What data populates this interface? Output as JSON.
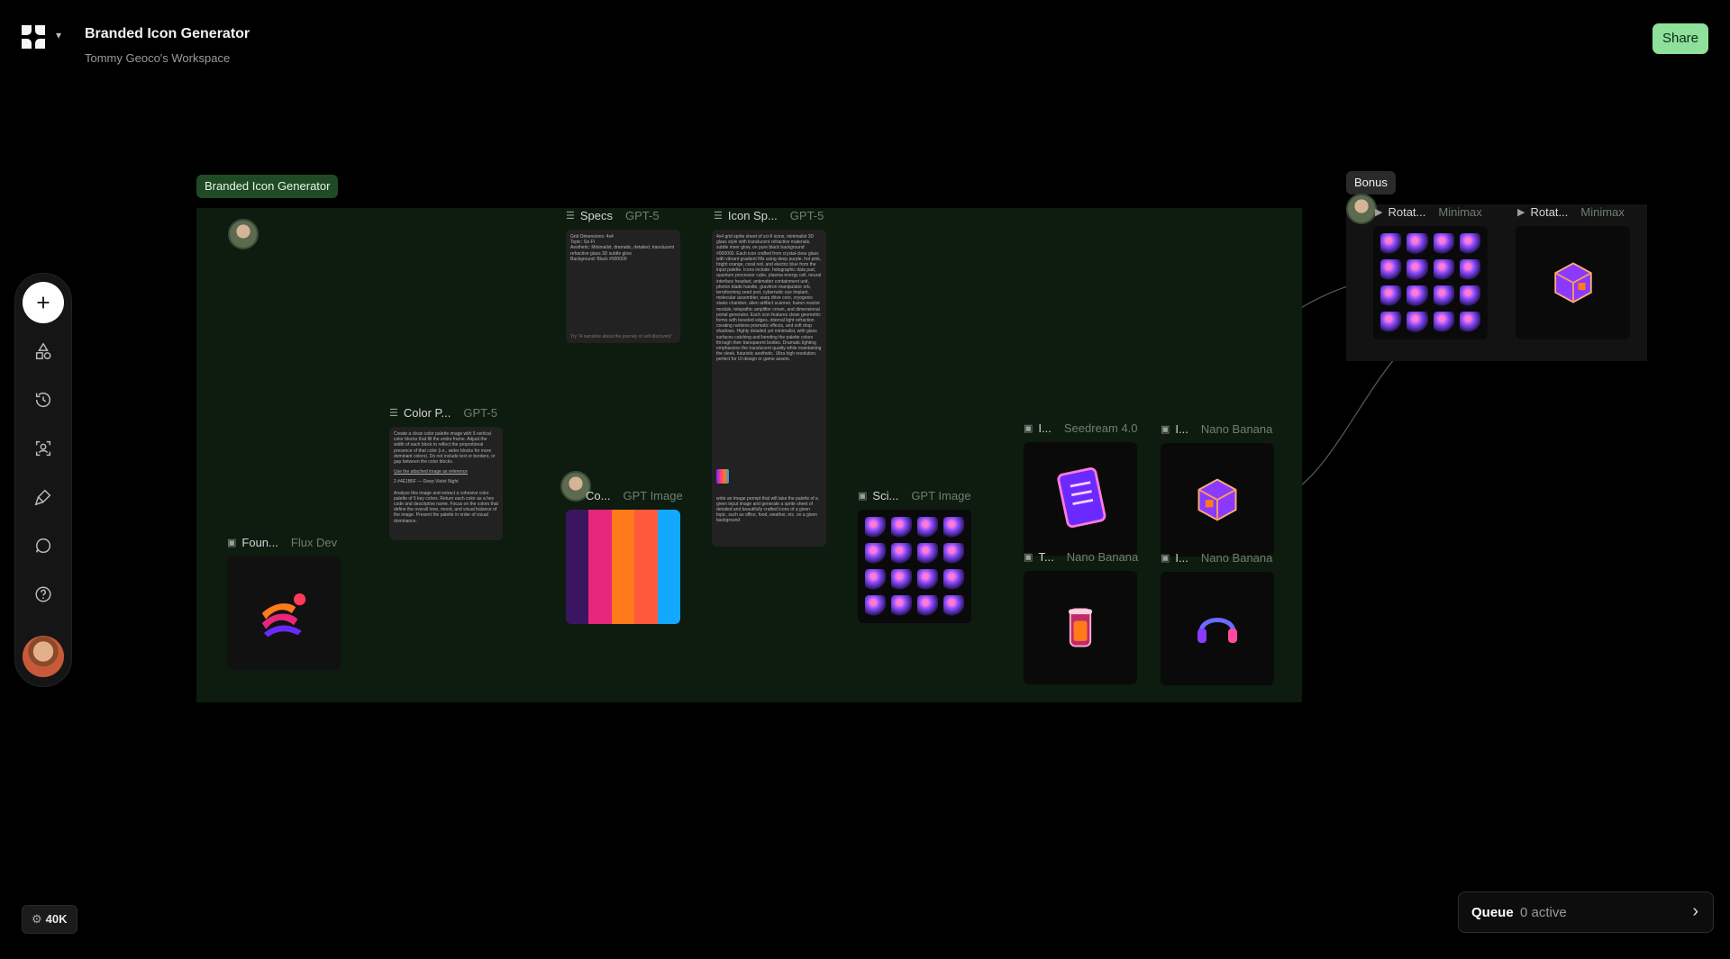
{
  "header": {
    "title": "Branded Icon Generator",
    "workspace": "Tommy Geoco's Workspace",
    "share_label": "Share"
  },
  "toolbar": {
    "items": [
      "add-icon",
      "shapes-icon",
      "history-icon",
      "scan-icon",
      "brush-icon",
      "chat-icon",
      "help-icon",
      "avatar"
    ]
  },
  "credits": {
    "value": "40K"
  },
  "queue": {
    "label": "Queue",
    "status": "0 active"
  },
  "groups": {
    "main": {
      "label": "Branded Icon Generator"
    },
    "bonus": {
      "label": "Bonus"
    }
  },
  "nodes": {
    "specs": {
      "title": "Specs",
      "model": "GPT-5",
      "text": "Grid Dimensions: 4x4\nTopic: Sci-Fi\nAesthetic: Minimalist, dramatic, detailed, translucent refractive glass 3D subtle glow\nBackground: Black #000000",
      "footer": "Try \"A narrative about the journey of self-discovery\""
    },
    "icon_spec": {
      "title": "Icon Sp...",
      "model": "GPT-5",
      "text": "4x4 grid sprite sheet of sci-fi icons, minimalist 3D glass style with translucent refractive materials, subtle inner glow, on pure black background #000000. Each icon crafted from crystal-clear glass with vibrant gradient fills using deep purple, hot pink, bright orange, coral red, and electric blue from the input palette. Icons include: holographic data pad, quantum processor cube, plasma energy cell, neural interface headset, antimatter containment unit, photon blade handle, gravitron manipulator orb, terraforming seed pod, cybernetic eye implant, molecular assembler, warp drive core, cryogenic stasis chamber, alien artifact scanner, fusion reactor module, telepathic amplifier crown, and dimensional portal generator. Each icon features clean geometric forms with beveled edges, internal light refraction creating rainbow prismatic effects, and soft drop shadows. Highly detailed yet minimalist, with glass surfaces catching and bending the palette colors through their transparent bodies. Dramatic lighting emphasizes the translucent quality while maintaining the sleek, futuristic aesthetic. Ultra high resolution, perfect for UI design or game assets.",
      "footer": "write an image prompt that will take the palette of a given input image and generate a sprite sheet of detailed and beautifully crafted icons of a given topic, such as office, food, weather, etc. on a given background"
    },
    "color_palette": {
      "title": "Color P...",
      "model": "GPT-5",
      "text": "Create a clean color palette image with 5 vertical color blocks that fill the entire frame. Adjust the width of each block to reflect the proportional presence of that color (i.e., wider blocks for more dominant colors). Do not include text or borders, or gap between the color blocks.",
      "mid": "Use the attached image as reference",
      "tag": "2 #4E1B5F — Deep Violet Night",
      "text2": "Analyze this image and extract a cohesive color palette of 5 key colors. Return each color as a hex code and descriptive name. Focus on the colors that define the overall tone, mood, and visual balance of the image. Present the palette in order of visual dominance."
    },
    "foundation": {
      "title": "Foun...",
      "model": "Flux Dev"
    },
    "color_image": {
      "title": "Co...",
      "model": "GPT Image",
      "palette": [
        "#3a1660",
        "#e6267a",
        "#ff7a1a",
        "#ff5a3c",
        "#12a8ff"
      ]
    },
    "scifi": {
      "title": "Sci...",
      "model": "GPT Image"
    },
    "seedream": {
      "title": "I...",
      "model": "Seedream 4.0"
    },
    "nano1": {
      "title": "I...",
      "model": "Nano Banana"
    },
    "nano2": {
      "title": "T...",
      "model": "Nano Banana"
    },
    "nano3": {
      "title": "I...",
      "model": "Nano Banana"
    },
    "rotate1": {
      "title": "Rotat...",
      "model": "Minimax"
    },
    "rotate2": {
      "title": "Rotat...",
      "model": "Minimax"
    }
  },
  "colors": {
    "accent": "#8ee09a",
    "group_bg": "#0e1b0f",
    "group_tag": "#1f4a24"
  }
}
